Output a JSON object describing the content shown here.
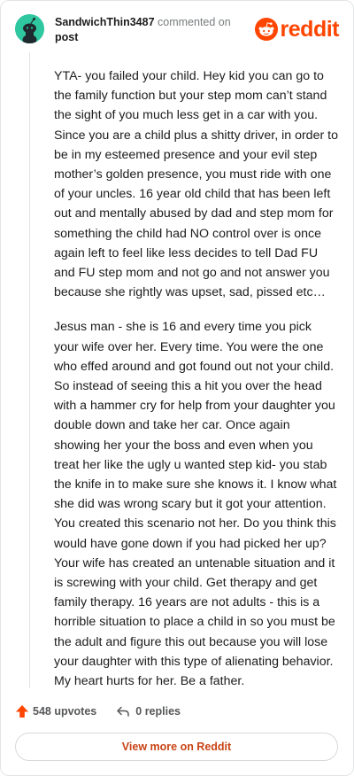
{
  "comment": {
    "username": "SandwichThin3487",
    "action": "commented on",
    "post_link": "post",
    "paragraphs": [
      "YTA- you failed your child. Hey kid you can go to the family function but your step mom can’t stand the sight of you much less get in a car with you. Since you are a child plus a shitty driver, in order to be in my esteemed presence and your evil step mother’s golden presence, you must ride with one of your uncles. 16 year old child that has been left out and mentally abused by dad and step mom for something the child had NO control over is once again left to feel like less decides to tell Dad FU and FU step mom and not go and not answer you because she rightly was upset, sad, pissed etc…",
      "Jesus man - she is 16 and every time you pick your wife over her. Every time. You were the one who effed around and got found out not your child. So instead of seeing this a hit you over the head with a hammer cry for help from your daughter you double down and take her car. Once again showing her your the boss and even when you treat her like the ugly u wanted step kid- you stab the knife in to make sure she knows it. I know what she did was wrong scary but it got your attention. You created this scenario not her. Do you think this would have gone down if you had picked her up? Your wife has created an untenable situation and it is screwing with your child. Get therapy and get family therapy. 16 years are not adults - this is a horrible situation to place a child in so you must be the adult and figure this out because you will lose your daughter with this type of alienating behavior. My heart hurts for her. Be a father."
    ]
  },
  "brand": {
    "wordmark": "reddit",
    "color": "#ff4500"
  },
  "footer": {
    "upvotes": "548 upvotes",
    "replies": "0 replies",
    "upvote_icon": "upvote-arrow-icon",
    "reply_icon": "reply-arrow-icon"
  },
  "cta": {
    "label": "View more on Reddit"
  },
  "colors": {
    "avatar_bg": "#2ec7a0",
    "upvote": "#ff4500",
    "cta_text": "#c94315"
  }
}
